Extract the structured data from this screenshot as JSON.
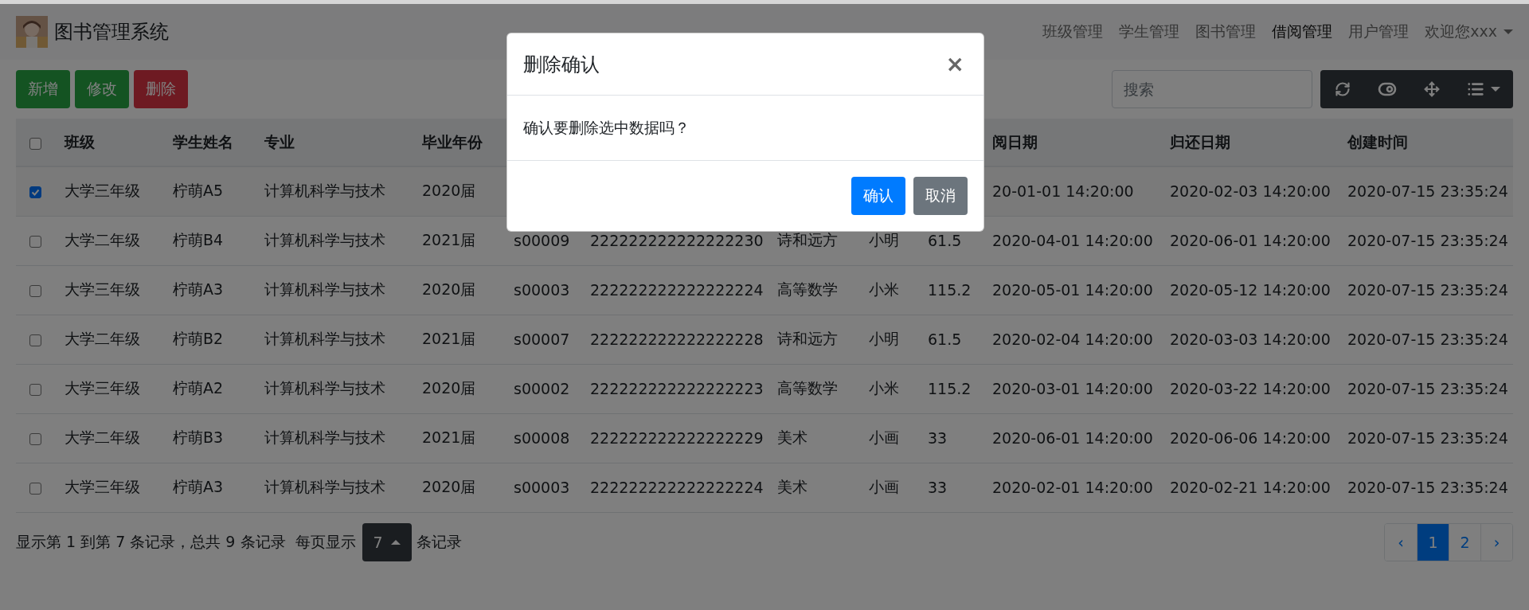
{
  "navbar": {
    "title": "图书管理系统",
    "links": [
      {
        "label": "班级管理",
        "selected": false
      },
      {
        "label": "学生管理",
        "selected": false
      },
      {
        "label": "图书管理",
        "selected": false
      },
      {
        "label": "借阅管理",
        "selected": true
      },
      {
        "label": "用户管理",
        "selected": false
      }
    ],
    "user_menu": "欢迎您xxx"
  },
  "toolbar": {
    "buttons": [
      {
        "label": "新增",
        "kind": "success"
      },
      {
        "label": "修改",
        "kind": "success"
      },
      {
        "label": "删除",
        "kind": "danger"
      }
    ],
    "search": {
      "placeholder": "搜索"
    }
  },
  "table": {
    "select_all": {
      "checked": false
    },
    "columns": [
      "班级",
      "学生姓名",
      "专业",
      "毕业年份",
      null,
      null,
      null,
      null,
      null,
      "阅日期",
      "归还日期",
      "创建时间"
    ],
    "rows": [
      {
        "checked": true,
        "cells": [
          "大学三年级",
          "柠萌A5",
          "计算机科学与技术",
          "2020届",
          null,
          null,
          null,
          null,
          null,
          "20-01-01 14:20:00",
          "2020-02-03 14:20:00",
          "2020-07-15 23:35:24"
        ]
      },
      {
        "checked": false,
        "cells": [
          "大学二年级",
          "柠萌B4",
          "计算机科学与技术",
          "2021届",
          "s00009",
          "222222222222222230",
          "诗和远方",
          "小明",
          "61.5",
          "2020-04-01 14:20:00",
          "2020-06-01 14:20:00",
          "2020-07-15 23:35:24"
        ]
      },
      {
        "checked": false,
        "cells": [
          "大学三年级",
          "柠萌A3",
          "计算机科学与技术",
          "2020届",
          "s00003",
          "222222222222222224",
          "高等数学",
          "小米",
          "115.2",
          "2020-05-01 14:20:00",
          "2020-05-12 14:20:00",
          "2020-07-15 23:35:24"
        ]
      },
      {
        "checked": false,
        "cells": [
          "大学二年级",
          "柠萌B2",
          "计算机科学与技术",
          "2021届",
          "s00007",
          "222222222222222228",
          "诗和远方",
          "小明",
          "61.5",
          "2020-02-04 14:20:00",
          "2020-03-03 14:20:00",
          "2020-07-15 23:35:24"
        ]
      },
      {
        "checked": false,
        "cells": [
          "大学三年级",
          "柠萌A2",
          "计算机科学与技术",
          "2020届",
          "s00002",
          "222222222222222223",
          "高等数学",
          "小米",
          "115.2",
          "2020-03-01 14:20:00",
          "2020-03-22 14:20:00",
          "2020-07-15 23:35:24"
        ]
      },
      {
        "checked": false,
        "cells": [
          "大学二年级",
          "柠萌B3",
          "计算机科学与技术",
          "2021届",
          "s00008",
          "222222222222222229",
          "美术",
          "小画",
          "33",
          "2020-06-01 14:20:00",
          "2020-06-06 14:20:00",
          "2020-07-15 23:35:24"
        ]
      },
      {
        "checked": false,
        "cells": [
          "大学三年级",
          "柠萌A3",
          "计算机科学与技术",
          "2020届",
          "s00003",
          "222222222222222224",
          "美术",
          "小画",
          "33",
          "2020-02-01 14:20:00",
          "2020-02-21 14:20:00",
          "2020-07-15 23:35:24"
        ]
      }
    ]
  },
  "footer": {
    "summary": "显示第 1 到第 7 条记录，总共 9 条记录",
    "page_size_label": "每页显示",
    "page_size": "7",
    "page_size_suffix": "条记录",
    "pages": [
      {
        "label": "‹",
        "selected": false
      },
      {
        "label": "1",
        "selected": true
      },
      {
        "label": "2",
        "selected": false
      },
      {
        "label": "›",
        "selected": false
      }
    ]
  },
  "modal": {
    "title": "删除确认",
    "close": "×",
    "message": "确认要删除选中数据吗？",
    "buttons": [
      {
        "label": "确认",
        "kind": "primary"
      },
      {
        "label": "取消",
        "kind": "secondary"
      }
    ]
  }
}
